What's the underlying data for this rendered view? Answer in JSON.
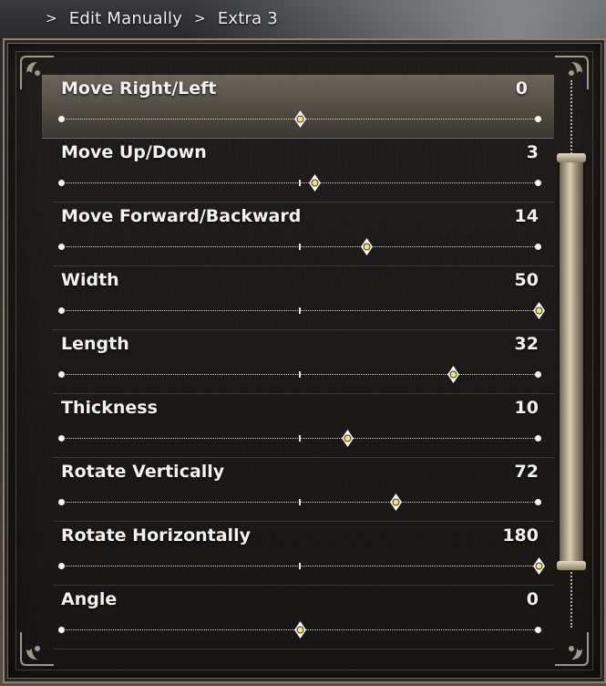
{
  "breadcrumb": {
    "items": [
      "Edit Manually",
      "Extra 3"
    ],
    "separator": ">"
  },
  "settings": [
    {
      "label": "Move Right/Left",
      "value": "0",
      "position": 0.5,
      "selected": true
    },
    {
      "label": "Move Up/Down",
      "value": "3",
      "position": 0.53
    },
    {
      "label": "Move Forward/Backward",
      "value": "14",
      "position": 0.64
    },
    {
      "label": "Width",
      "value": "50",
      "position": 1.0
    },
    {
      "label": "Length",
      "value": "32",
      "position": 0.82
    },
    {
      "label": "Thickness",
      "value": "10",
      "position": 0.6
    },
    {
      "label": "Rotate Vertically",
      "value": "72",
      "position": 0.7
    },
    {
      "label": "Rotate Horizontally",
      "value": "180",
      "position": 1.0
    },
    {
      "label": "Angle",
      "value": "0",
      "position": 0.5
    }
  ],
  "scrollbar": {
    "position": 0.0
  },
  "colors": {
    "handle_fill": "#f5e65a",
    "handle_outline": "#ffffff",
    "text": "#f2f2f2"
  }
}
